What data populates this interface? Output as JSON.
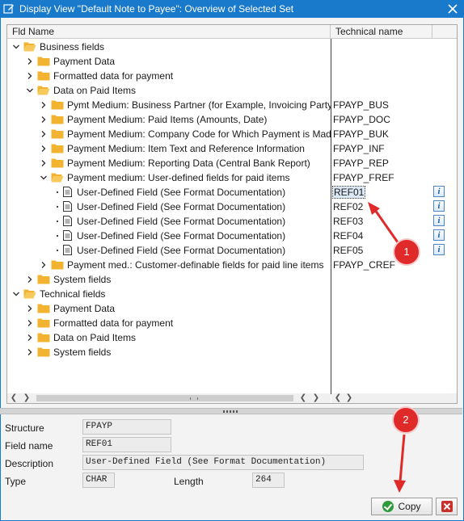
{
  "window": {
    "title": "Display View \"Default Note to Payee\": Overview of Selected Set"
  },
  "tree": {
    "headers": {
      "fld_name": "Fld Name",
      "technical_name": "Technical name"
    },
    "rows": [
      {
        "label": "Business fields",
        "tech": "",
        "kind": "folder",
        "state": "open",
        "info": false,
        "selected": false
      },
      {
        "label": "Payment Data",
        "tech": "",
        "kind": "folder",
        "state": "closed",
        "info": false,
        "selected": false
      },
      {
        "label": "Formatted data for payment",
        "tech": "",
        "kind": "folder",
        "state": "closed",
        "info": false,
        "selected": false
      },
      {
        "label": "Data on Paid Items",
        "tech": "",
        "kind": "folder",
        "state": "open",
        "info": false,
        "selected": false
      },
      {
        "label": "Pymt Medium: Business Partner (for Example, Invoicing Party)",
        "tech": "FPAYP_BUS",
        "kind": "folder",
        "state": "closed",
        "info": false,
        "selected": false
      },
      {
        "label": "Payment Medium: Paid Items (Amounts, Date)",
        "tech": "FPAYP_DOC",
        "kind": "folder",
        "state": "closed",
        "info": false,
        "selected": false
      },
      {
        "label": "Payment Medium: Company Code for Which Payment is Made",
        "tech": "FPAYP_BUK",
        "kind": "folder",
        "state": "closed",
        "info": false,
        "selected": false
      },
      {
        "label": "Payment Medium: Item Text and Reference Information",
        "tech": "FPAYP_INF",
        "kind": "folder",
        "state": "closed",
        "info": false,
        "selected": false
      },
      {
        "label": "Payment Medium: Reporting Data (Central Bank Report)",
        "tech": "FPAYP_REP",
        "kind": "folder",
        "state": "closed",
        "info": false,
        "selected": false
      },
      {
        "label": "Payment medium: User-defined fields for paid items",
        "tech": "FPAYP_FREF",
        "kind": "folder",
        "state": "open",
        "info": false,
        "selected": false
      },
      {
        "label": "User-Defined Field (See Format Documentation)",
        "tech": "REF01",
        "kind": "doc",
        "state": "leaf",
        "info": true,
        "selected": true
      },
      {
        "label": "User-Defined Field (See Format Documentation)",
        "tech": "REF02",
        "kind": "doc",
        "state": "leaf",
        "info": true,
        "selected": false
      },
      {
        "label": "User-Defined Field (See Format Documentation)",
        "tech": "REF03",
        "kind": "doc",
        "state": "leaf",
        "info": true,
        "selected": false
      },
      {
        "label": "User-Defined Field (See Format Documentation)",
        "tech": "REF04",
        "kind": "doc",
        "state": "leaf",
        "info": true,
        "selected": false
      },
      {
        "label": "User-Defined Field (See Format Documentation)",
        "tech": "REF05",
        "kind": "doc",
        "state": "leaf",
        "info": true,
        "selected": false
      },
      {
        "label": "Payment med.: Customer-definable fields for paid line items",
        "tech": "FPAYP_CREF",
        "kind": "folder",
        "state": "closed",
        "info": false,
        "selected": false
      },
      {
        "label": "System fields",
        "tech": "",
        "kind": "folder",
        "state": "closed",
        "info": false,
        "selected": false
      },
      {
        "label": "Technical fields",
        "tech": "",
        "kind": "folder",
        "state": "open",
        "info": false,
        "selected": false
      },
      {
        "label": "Payment Data",
        "tech": "",
        "kind": "folder",
        "state": "closed",
        "info": false,
        "selected": false
      },
      {
        "label": "Formatted data for payment",
        "tech": "",
        "kind": "folder",
        "state": "closed",
        "info": false,
        "selected": false
      },
      {
        "label": "Data on Paid Items",
        "tech": "",
        "kind": "folder",
        "state": "closed",
        "info": false,
        "selected": false
      },
      {
        "label": "System fields",
        "tech": "",
        "kind": "folder",
        "state": "closed",
        "info": false,
        "selected": false
      }
    ]
  },
  "details": {
    "structure_label": "Structure",
    "structure_value": "FPAYP",
    "field_name_label": "Field name",
    "field_name_value": "REF01",
    "description_label": "Description",
    "description_value": "User-Defined Field (See Format Documentation)",
    "type_label": "Type",
    "type_value": "CHAR",
    "length_label": "Length",
    "length_value": "264"
  },
  "buttons": {
    "copy_label": "Copy"
  },
  "annotations": {
    "badge1": "1",
    "badge2": "2"
  },
  "colors": {
    "titlebar": "#1979ca",
    "folder": "#f2b331",
    "badge": "#e02a2a",
    "ok": "#2f9a3b",
    "cancel": "#c9302c"
  }
}
